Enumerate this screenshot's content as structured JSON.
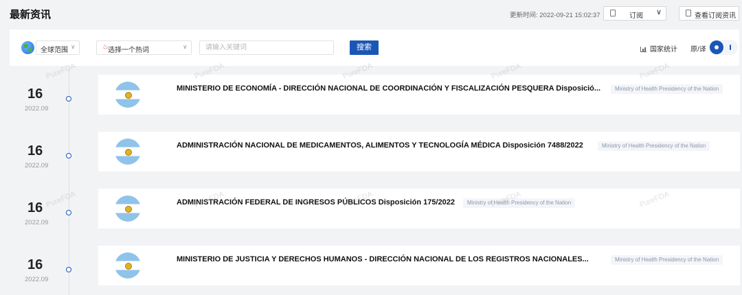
{
  "header": {
    "title": "最新资讯",
    "update_time": "更新时间: 2022-09-21 15:02:37",
    "subscribe_label": "订阅",
    "view_subscription_label": "查看订阅资讯"
  },
  "filters": {
    "scope_label": "全球范围",
    "hot_word_label": "选择一个热词",
    "keyword_placeholder": "请输入关键词",
    "keyword_value": "",
    "search_label": "搜索",
    "stats_label": "国家统计",
    "translate_label": "原/译"
  },
  "watermark_text": "PureFDA",
  "entries": [
    {
      "day": "16",
      "year_month": "2022.09",
      "title": "MINISTERIO DE ECONOMÍA - DIRECCIÓN NACIONAL DE COORDINACIÓN Y FISCALIZACIÓN PESQUERA Disposició...",
      "source": "Ministry of Health Presidency of the Nation"
    },
    {
      "day": "16",
      "year_month": "2022.09",
      "title": "ADMINISTRACIÓN NACIONAL DE MEDICAMENTOS, ALIMENTOS Y TECNOLOGÍA MÉDICA Disposición 7488/2022",
      "source": "Ministry of Health Presidency of the Nation"
    },
    {
      "day": "16",
      "year_month": "2022.09",
      "title": "ADMINISTRACIÓN FEDERAL DE INGRESOS PÚBLICOS Disposición 175/2022",
      "source": "Ministry of Health Presidency of the Nation"
    },
    {
      "day": "16",
      "year_month": "2022.09",
      "title": "MINISTERIO DE JUSTICIA Y DERECHOS HUMANOS - DIRECCIÓN NACIONAL DE LOS REGISTROS NACIONALES...",
      "source": "Ministry of Health Presidency of the Nation"
    }
  ]
}
